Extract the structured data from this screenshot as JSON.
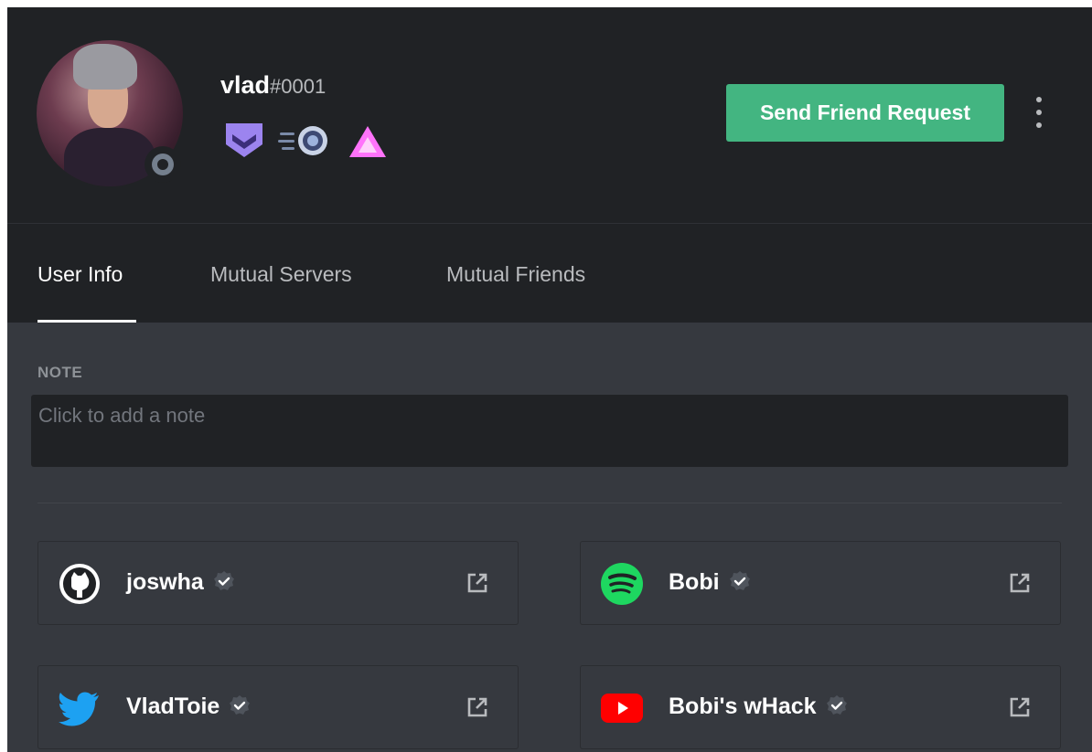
{
  "user": {
    "username": "vlad",
    "discriminator": "#0001",
    "status": "offline",
    "badges": [
      "hypesquad-balance-icon",
      "early-supporter-icon",
      "nitro-boost-icon"
    ]
  },
  "actions": {
    "send_friend_request": "Send Friend Request"
  },
  "tabs": [
    {
      "label": "User Info",
      "active": true
    },
    {
      "label": "Mutual Servers",
      "active": false
    },
    {
      "label": "Mutual Friends",
      "active": false
    }
  ],
  "note": {
    "label": "NOTE",
    "placeholder": "Click to add a note",
    "value": ""
  },
  "connections": [
    {
      "service": "github",
      "icon": "github-icon",
      "name": "joswha",
      "verified": true
    },
    {
      "service": "spotify",
      "icon": "spotify-icon",
      "name": "Bobi",
      "verified": true
    },
    {
      "service": "twitter",
      "icon": "twitter-icon",
      "name": "VladToie",
      "verified": true
    },
    {
      "service": "youtube",
      "icon": "youtube-icon",
      "name": "Bobi's wHack",
      "verified": true
    }
  ],
  "colors": {
    "accent_green": "#43b581",
    "header_bg": "#202225",
    "body_bg": "#36393f",
    "spotify": "#1ed760",
    "twitter": "#1da1f2",
    "youtube": "#ff0000",
    "badge_purple": "#9c84ef",
    "nitro_pink": "#ff73fa"
  }
}
